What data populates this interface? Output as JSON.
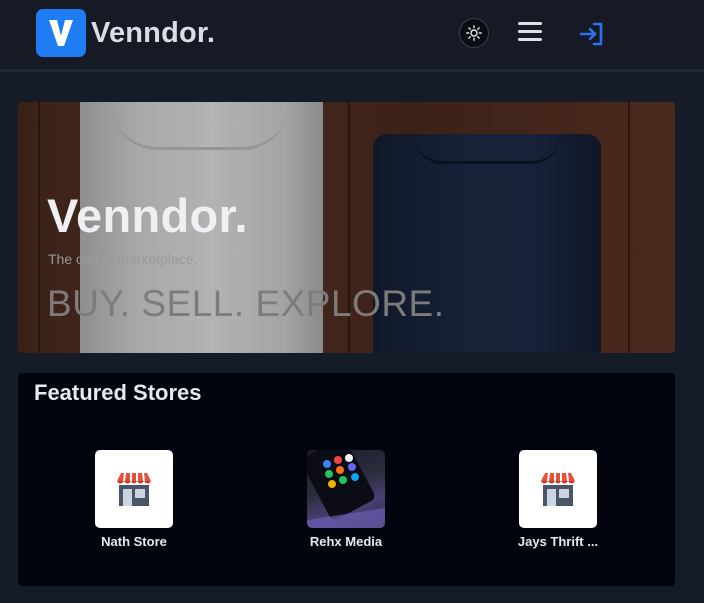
{
  "header": {
    "logo_letter": "V",
    "brand": "Venndor.",
    "icons": {
      "theme": "sun-icon",
      "menu": "hamburger-menu-icon",
      "login": "login-icon"
    },
    "colors": {
      "accent": "#1f7cf2"
    }
  },
  "hero": {
    "title": "Venndor.",
    "subtitle": "The online marketplace.",
    "tagline": "BUY. SELL. EXPLORE."
  },
  "featured": {
    "title": "Featured Stores",
    "stores": [
      {
        "name": "Nath Store",
        "icon": "storefront-icon"
      },
      {
        "name": "Rehx Media",
        "icon": "phone-image"
      },
      {
        "name": "Jays Thrift ...",
        "icon": "storefront-icon"
      }
    ]
  }
}
